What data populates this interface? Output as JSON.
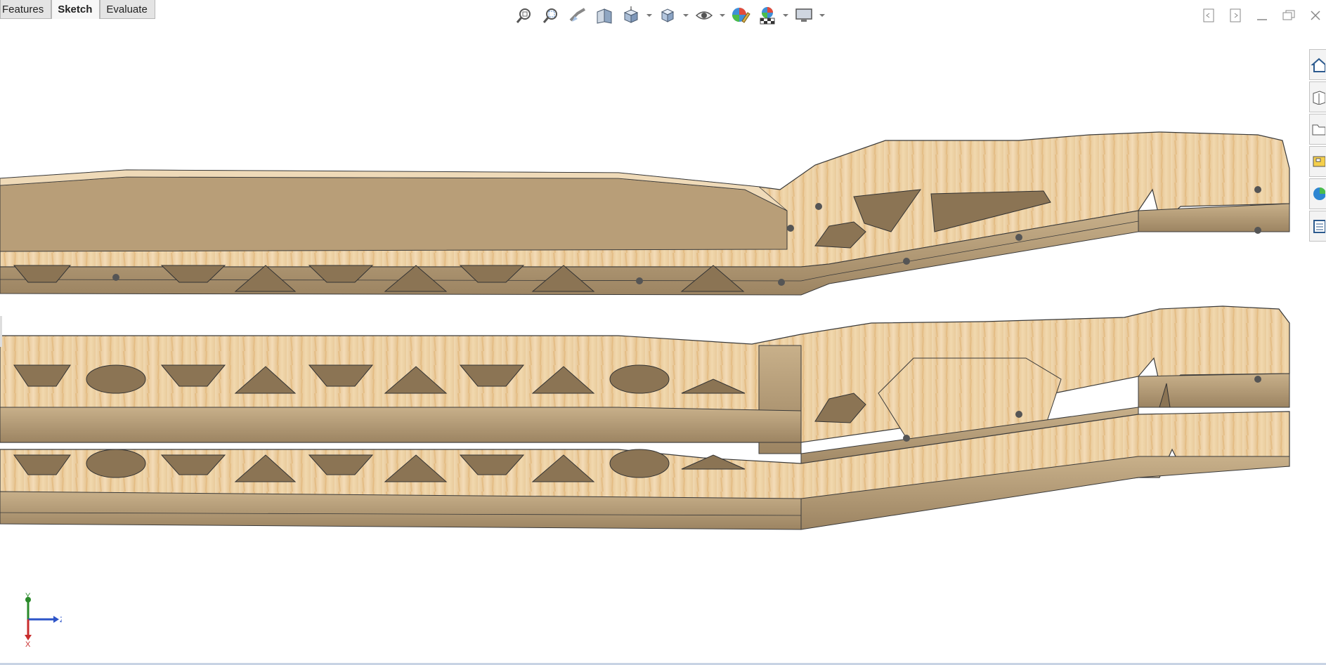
{
  "command_manager": {
    "tabs": [
      {
        "label": "Features",
        "active": false
      },
      {
        "label": "Sketch",
        "active": true
      },
      {
        "label": "Evaluate",
        "active": false
      }
    ]
  },
  "heads_up_toolbar": {
    "tools": [
      {
        "icon": "zoom-to-fit-icon"
      },
      {
        "icon": "zoom-to-area-icon"
      },
      {
        "icon": "previous-view-icon"
      },
      {
        "icon": "section-view-icon"
      },
      {
        "icon": "view-orientation-icon",
        "has_dropdown": true
      },
      {
        "icon": "display-style-icon",
        "has_dropdown": true
      },
      {
        "icon": "hide-show-items-icon",
        "has_dropdown": true
      },
      {
        "icon": "edit-appearance-icon"
      },
      {
        "icon": "apply-scene-icon",
        "has_dropdown": true
      },
      {
        "icon": "view-settings-icon",
        "has_dropdown": true
      }
    ]
  },
  "window_controls": [
    "tile-left-icon",
    "tile-right-icon",
    "minimize-icon",
    "restore-icon",
    "close-icon"
  ],
  "task_pane": [
    "solidworks-resources-icon",
    "design-library-icon",
    "file-explorer-icon",
    "view-palette-icon",
    "appearances-scenes-icon",
    "custom-properties-icon"
  ],
  "triad": {
    "y_label": "Y",
    "z_label": "Z",
    "x_label": "X"
  },
  "colors": {
    "wood": "#ebcfa2",
    "wood_side": "#b39a73",
    "accent": "#1f6fbf"
  }
}
